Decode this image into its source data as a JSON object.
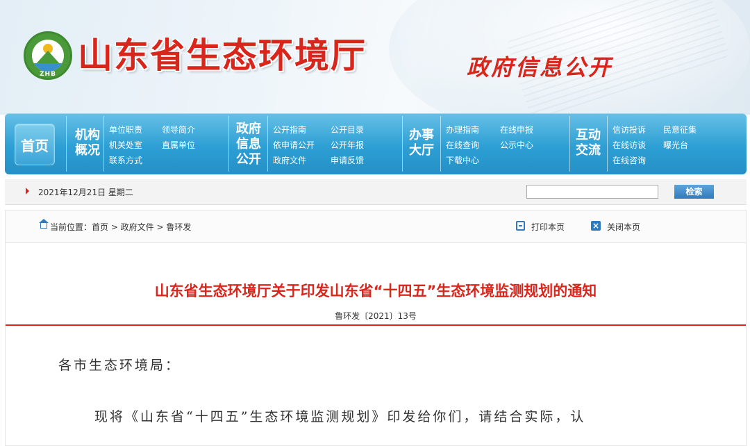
{
  "header": {
    "logo_text": "ZHB",
    "site_title": "山东省生态环境厅",
    "subtitle": "政府信息公开"
  },
  "nav": {
    "home": "首页",
    "sections": [
      {
        "title": [
          "机构",
          "概况"
        ],
        "links": [
          "单位职责",
          "领导简介",
          "机关处室",
          "直属单位",
          "联系方式"
        ]
      },
      {
        "title": [
          "政府",
          "信息",
          "公开"
        ],
        "links": [
          "公开指南",
          "公开目录",
          "依申请公开",
          "公开年报",
          "政府文件",
          "申请反馈"
        ]
      },
      {
        "title": [
          "办事",
          "大厅"
        ],
        "links": [
          "办理指南",
          "在线申报",
          "在线查询",
          "公示中心",
          "下载中心"
        ]
      },
      {
        "title": [
          "互动",
          "交流"
        ],
        "links": [
          "信访投诉",
          "民意征集",
          "在线访谈",
          "曝光台",
          "在线咨询"
        ]
      }
    ]
  },
  "datebar": {
    "date": "2021年12月21日 星期二",
    "search_value": "",
    "search_button": "检索"
  },
  "breadcrumb": {
    "text": "当前位置：首页 > 政府文件 > 鲁环发",
    "print": "打印本页",
    "close": "关闭本页"
  },
  "document": {
    "title": "山东省生态环境厅关于印发山东省“十四五”生态环境监测规划的通知",
    "number": "鲁环发〔2021〕13号",
    "greeting": "各市生态环境局：",
    "paragraph": "现将《山东省“十四五”生态环境监测规划》印发给你们，请结合实际，认"
  },
  "colors": {
    "accent_red": "#d8261c",
    "nav_blue": "#2d9fd4",
    "link_blue": "#2f7bbf"
  }
}
